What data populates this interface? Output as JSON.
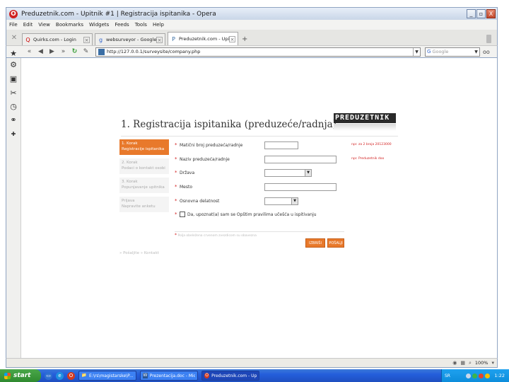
{
  "window": {
    "title": "Preduzetnik.com - Upitnik #1 | Registracija ispitanika - Opera",
    "buttons": {
      "minimize": "_",
      "maximize": "▫",
      "close": "X"
    }
  },
  "menu": [
    "File",
    "Edit",
    "View",
    "Bookmarks",
    "Widgets",
    "Feeds",
    "Tools",
    "Help"
  ],
  "tabs": [
    {
      "label": "Quirks.com - Login",
      "favicon": "Q"
    },
    {
      "label": "websurveyor - Google pre...",
      "favicon": "g"
    },
    {
      "label": "Preduzetnik.com - Upitnik ...",
      "favicon": "P"
    }
  ],
  "new_tab_symbol": "+",
  "address": {
    "url": "http://127.0.0.1/surveysite/company.php"
  },
  "search": {
    "engine_icon": "G",
    "placeholder": "Google"
  },
  "page": {
    "title": "1. Registracija ispitanika (preduzeće/radnja)",
    "logo_text": "PREDUZETNIK",
    "steps": [
      {
        "line1": "1. Korak",
        "line2": "Registracije ispitanika"
      },
      {
        "line1": "2. Korak",
        "line2": "Podaci o kontakt osobi"
      },
      {
        "line1": "3. Korak",
        "line2": "Popunjavanje upitnika"
      },
      {
        "line1": "Prijava",
        "line2": "Napravite anketu"
      }
    ],
    "fields": [
      {
        "label": "Matični broj preduzeća/radnje",
        "hint": "npr. za 2 broja 20123000"
      },
      {
        "label": "Naziv preduzeća/radnje",
        "hint": "npr. Preduzetnik doo"
      },
      {
        "label": "Država"
      },
      {
        "label": "Mesto"
      },
      {
        "label": "Osnovna delatnost"
      }
    ],
    "required_marker": "*",
    "select_arrow": "▼",
    "agreement": "Da, upoznat(a) sam se Opštim pravilima učešća u ispitivanju",
    "note": "Polja obeležena crvenom zvezdicom su obavezna",
    "buttons": {
      "reset": "IZBRIŠI",
      "submit": "POŠALJI"
    },
    "footer_link": "» Pošaljite  » Kontakt"
  },
  "statusbar": {
    "zoom": "100%"
  },
  "taskbar": {
    "start_label": "start",
    "tasks": [
      {
        "label": "E:\\rs\\magistarske\\P...",
        "icon": "📁"
      },
      {
        "label": "Prezentacija.doc - Micro...",
        "icon": "W"
      },
      {
        "label": "Preduzetnik.com - Upi...",
        "icon": "O"
      }
    ],
    "lang": "SR",
    "clock": "1:22"
  }
}
